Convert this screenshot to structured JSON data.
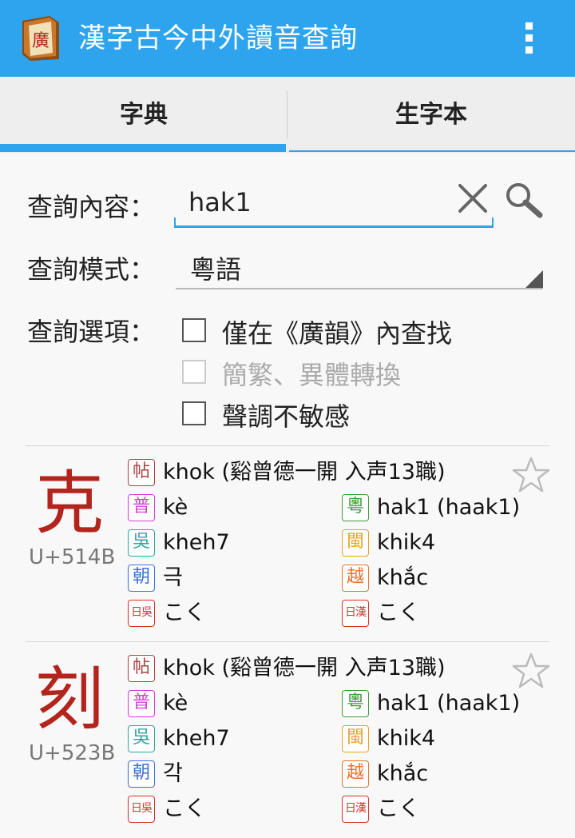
{
  "app": {
    "title": "漢字古今中外讀音查詢",
    "icon_char": "廣",
    "icon": "book-icon",
    "accent": "#2ea4ee"
  },
  "tabs": [
    {
      "label": "字典",
      "active": true
    },
    {
      "label": "生字本",
      "active": false
    }
  ],
  "search": {
    "label": "查詢內容：",
    "value": "hak1",
    "mode_label": "查詢模式：",
    "mode_value": "粵語",
    "options_label": "查詢選項：",
    "options": [
      {
        "label": "僅在《廣韻》內查找",
        "checked": false,
        "enabled": true
      },
      {
        "label": "簡繁、異體轉換",
        "checked": false,
        "enabled": false
      },
      {
        "label": "聲調不敏感",
        "checked": false,
        "enabled": true
      }
    ]
  },
  "results": [
    {
      "char": "克",
      "codepoint": "U+514B",
      "guangyun": {
        "tag": "帖",
        "reading": "khok (谿曾德一開 入声13職)"
      },
      "readings": [
        {
          "tag": "普",
          "value": "kè",
          "color": "#d63bd6"
        },
        {
          "tag": "粵",
          "value": "hak1 (haak1)",
          "color": "#3c9a3c"
        },
        {
          "tag": "吳",
          "value": "kheh7",
          "color": "#2aa7a0"
        },
        {
          "tag": "閩",
          "value": "khik4",
          "color": "#e8a11c"
        },
        {
          "tag": "朝",
          "value": "극",
          "color": "#3d6fd6"
        },
        {
          "tag": "越",
          "value": "khắc",
          "color": "#e9702a"
        },
        {
          "tag": "日吳",
          "value": "こく",
          "color": "#d8302a"
        },
        {
          "tag": "日漢",
          "value": "こく",
          "color": "#d8302a"
        }
      ]
    },
    {
      "char": "刻",
      "codepoint": "U+523B",
      "guangyun": {
        "tag": "帖",
        "reading": "khok (谿曾德一開 入声13職)"
      },
      "readings": [
        {
          "tag": "普",
          "value": "kè",
          "color": "#d63bd6"
        },
        {
          "tag": "粵",
          "value": "hak1 (haak1)",
          "color": "#3c9a3c"
        },
        {
          "tag": "吳",
          "value": "kheh7",
          "color": "#2aa7a0"
        },
        {
          "tag": "閩",
          "value": "khik4",
          "color": "#e8a11c"
        },
        {
          "tag": "朝",
          "value": "각",
          "color": "#3d6fd6"
        },
        {
          "tag": "越",
          "value": "khắc",
          "color": "#e9702a"
        },
        {
          "tag": "日吳",
          "value": "こく",
          "color": "#d8302a"
        },
        {
          "tag": "日漢",
          "value": "こく",
          "color": "#d8302a"
        }
      ]
    }
  ]
}
